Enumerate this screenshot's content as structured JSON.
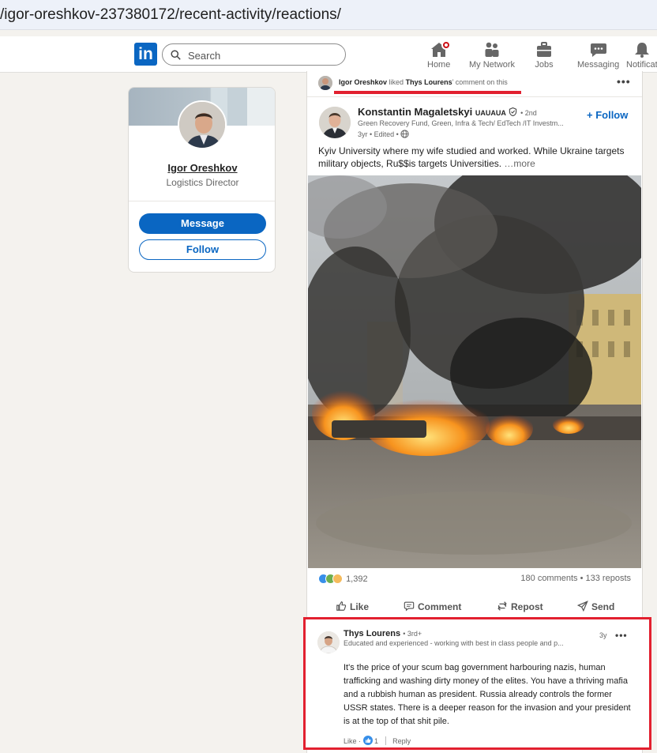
{
  "browser": {
    "url": "/igor-oreshkov-237380172/recent-activity/reactions/"
  },
  "nav": {
    "search_placeholder": "Search",
    "items": [
      {
        "label": "Home",
        "icon": "home-icon"
      },
      {
        "label": "My Network",
        "icon": "network-icon"
      },
      {
        "label": "Jobs",
        "icon": "briefcase-icon"
      },
      {
        "label": "Messaging",
        "icon": "messaging-icon"
      },
      {
        "label": "Notificat",
        "icon": "bell-icon"
      }
    ]
  },
  "profile": {
    "name": "Igor Oreshkov",
    "title": "Logistics Director",
    "message_label": "Message",
    "follow_label": "Follow"
  },
  "activity": {
    "actor": "Igor Oreshkov",
    "verb": "liked",
    "target": "Thys Lourens",
    "suffix": "comment on this",
    "highlight_color": "#e2202f"
  },
  "post": {
    "author": "Konstantin Magaletskyi",
    "author_flag": "UAUAUA",
    "degree": "• 2nd",
    "headline": "Green Recovery Fund, Green, Infra & Tech/ EdTech /IT Investm...",
    "meta": "3yr • Edited •",
    "follow_label": "+ Follow",
    "text": "Kyiv University where my wife studied and worked. While Ukraine targets military objects, Ru$$is targets Universities.",
    "more_label": "…more",
    "reaction_count": "1,392",
    "comments_reposts": "180 comments • 133 reposts",
    "actions": [
      "Like",
      "Comment",
      "Repost",
      "Send"
    ]
  },
  "comment": {
    "author": "Thys Lourens",
    "degree": "• 3rd+",
    "headline": "Educated and experienced - working with best in class people and p...",
    "time": "3y",
    "text": "It's the price of your scum bag government harbouring nazis, human trafficking and washing dirty money of the elites. You have a thriving mafia and a rubbish human as president. Russia already controls the former USSR states. There is a deeper reason for the invasion and your president is at the top of that shit pile.",
    "like_label": "Like",
    "like_count": "1",
    "reply_label": "Reply"
  },
  "colors": {
    "brand": "#0a66c2",
    "highlight": "#e2202f"
  }
}
